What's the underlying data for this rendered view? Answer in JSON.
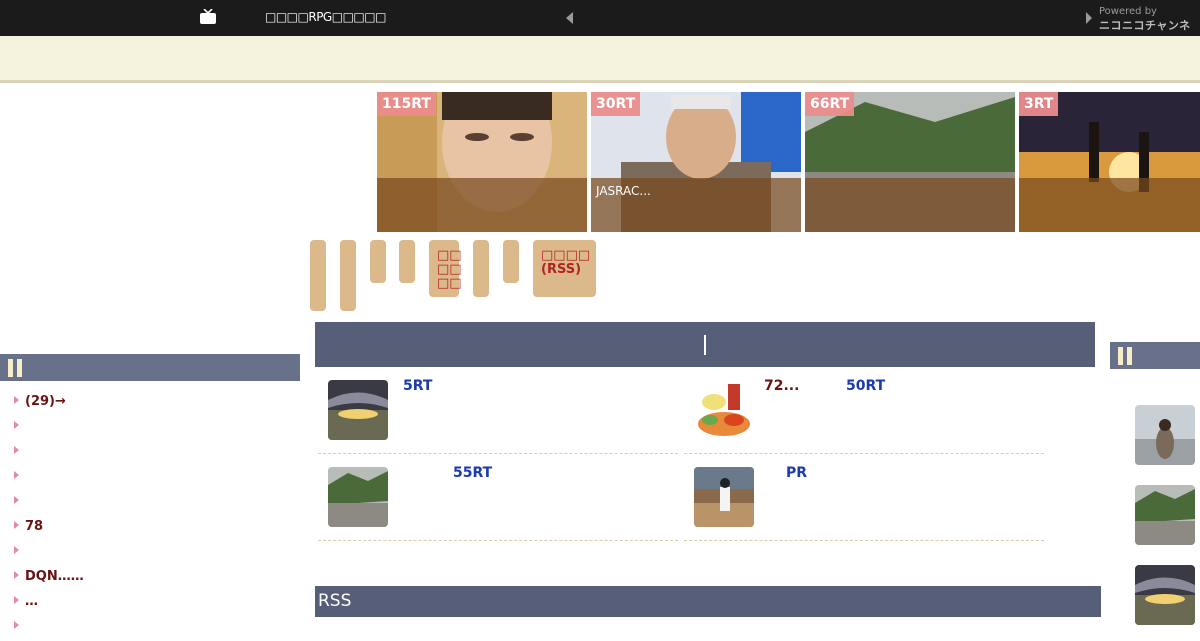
{
  "topbar": {
    "site_title": "□□□□RPG□□□□□",
    "powered_by": "Powered by",
    "channel": "ニコニコチャンネル"
  },
  "featured": [
    {
      "rt": "115RT",
      "caption": ""
    },
    {
      "rt": "30RT",
      "caption": "JASRAC..."
    },
    {
      "rt": "66RT",
      "caption": ""
    },
    {
      "rt": "3RT",
      "caption": ""
    }
  ],
  "nav": {
    "pill_text_1": "□□\n□□\n□□",
    "pill_text_2": "□□□□\n(RSS)"
  },
  "left_list": [
    {
      "label": "(29)→"
    },
    {
      "label": ""
    },
    {
      "label": ""
    },
    {
      "label": ""
    },
    {
      "label": ""
    },
    {
      "label": "78"
    },
    {
      "label": ""
    },
    {
      "label": "DQN……"
    },
    {
      "label": "…"
    },
    {
      "label": ""
    }
  ],
  "articles": [
    {
      "meta_1": "5RT",
      "meta_2": ""
    },
    {
      "meta_1": "72...",
      "meta_2": "50RT"
    },
    {
      "meta_1": "55RT",
      "meta_2": ""
    },
    {
      "meta_1": "PR",
      "meta_2": ""
    }
  ],
  "rss_section": {
    "title": "RSS"
  },
  "colors": {
    "topbar": "#1b1b1b",
    "banner": "#f5f3dd",
    "header": "#575e78",
    "pill": "#dcb98a",
    "rt_badge": "#ea8c8c"
  }
}
